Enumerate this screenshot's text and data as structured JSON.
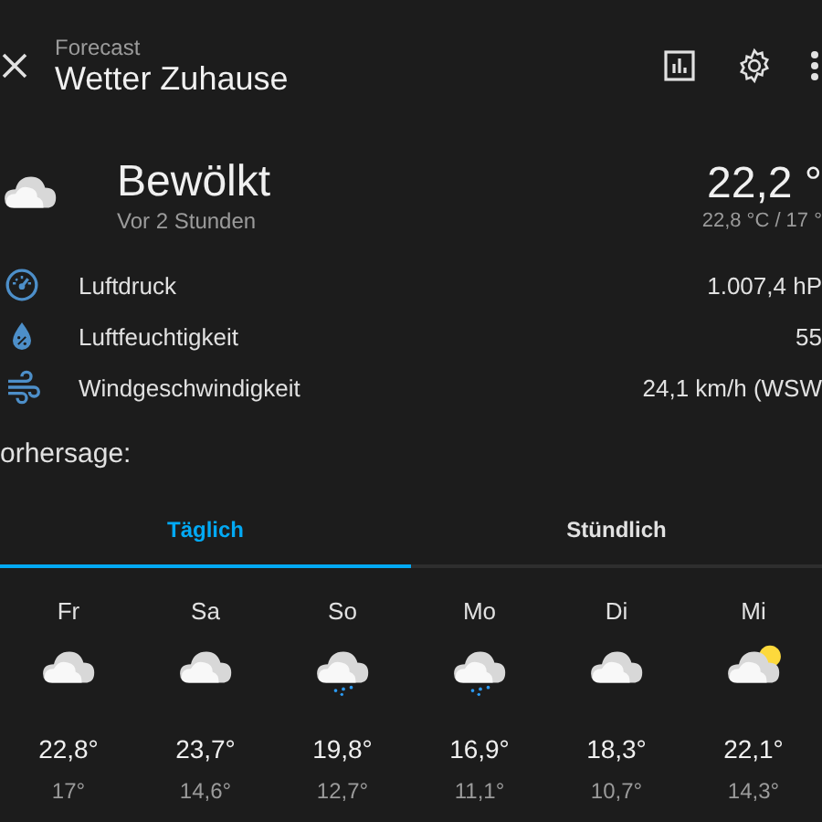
{
  "header": {
    "subtitle": "Forecast",
    "title": "Wetter Zuhause"
  },
  "current": {
    "condition": "Bewölkt",
    "kind": "cloudy",
    "updated": "Vor 2 Stunden",
    "temperature": "22,2 °",
    "range": "22,8 °C / 17 °"
  },
  "attributes": [
    {
      "kind": "pressure",
      "label": "Luftdruck",
      "value": "1.007,4 hP"
    },
    {
      "kind": "humidity",
      "label": "Luftfeuchtigkeit",
      "value": "55"
    },
    {
      "kind": "wind",
      "label": "Windgeschwindigkeit",
      "value": "24,1 km/h (WSW"
    }
  ],
  "forecast_heading": "orhersage:",
  "tabs": [
    {
      "label": "Täglich",
      "selected": true
    },
    {
      "label": "Stündlich",
      "selected": false
    }
  ],
  "days": [
    {
      "day": "Fr",
      "kind": "cloudy",
      "high": "22,8°",
      "low": "17°"
    },
    {
      "day": "Sa",
      "kind": "cloudy",
      "high": "23,7°",
      "low": "14,6°"
    },
    {
      "day": "So",
      "kind": "rainy",
      "high": "19,8°",
      "low": "12,7°"
    },
    {
      "day": "Mo",
      "kind": "rainy",
      "high": "16,9°",
      "low": "11,1°"
    },
    {
      "day": "Di",
      "kind": "cloudy",
      "high": "18,3°",
      "low": "10,7°"
    },
    {
      "day": "Mi",
      "kind": "partlycloudy",
      "high": "22,1°",
      "low": "14,3°"
    }
  ]
}
